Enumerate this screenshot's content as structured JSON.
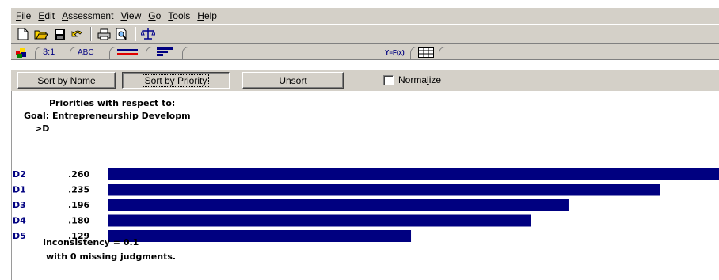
{
  "menu": [
    {
      "label": "File",
      "u": "F"
    },
    {
      "label": "Edit",
      "u": "E"
    },
    {
      "label": "Assessment",
      "u": "A"
    },
    {
      "label": "View",
      "u": "V"
    },
    {
      "label": "Go",
      "u": "G"
    },
    {
      "label": "Tools",
      "u": "T"
    },
    {
      "label": "Help",
      "u": "H"
    }
  ],
  "toolbar_icons": [
    "new-document-icon",
    "open-folder-icon",
    "save-disk-icon",
    "undo-icon",
    "print-icon",
    "print-preview-icon",
    "balance-scale-icon"
  ],
  "tabs": [
    {
      "name": "tab-model",
      "label": ""
    },
    {
      "name": "tab-numerical",
      "label": "3:1"
    },
    {
      "name": "tab-verbal",
      "label": "ABC"
    },
    {
      "name": "tab-graphical",
      "label": ""
    },
    {
      "name": "tab-priorities",
      "label": ""
    },
    {
      "name": "tab-formula",
      "label": "Y=F(x)"
    },
    {
      "name": "tab-grid",
      "label": ""
    }
  ],
  "sortbar": {
    "sort_name": "Sort by Name",
    "sort_priority": "Sort by Priority",
    "unsort": "Unsort",
    "normalize": "Normalize",
    "normalize_checked": false
  },
  "header": {
    "line1": "Priorities with respect to:",
    "line2": "Goal: Entrepreneurship Developm",
    "line3": ">D"
  },
  "chart_data": {
    "type": "bar",
    "orientation": "horizontal",
    "categories": [
      "D2",
      "D1",
      "D3",
      "D4",
      "D5"
    ],
    "values": [
      0.26,
      0.235,
      0.196,
      0.18,
      0.129
    ],
    "value_labels": [
      ".260",
      ".235",
      ".196",
      ".180",
      ".129"
    ],
    "bar_color": "#000080",
    "label_color": "#000080"
  },
  "footer": {
    "inconsistency": "Inconsistency = 0.1",
    "missing": "with 0  missing judgments."
  }
}
